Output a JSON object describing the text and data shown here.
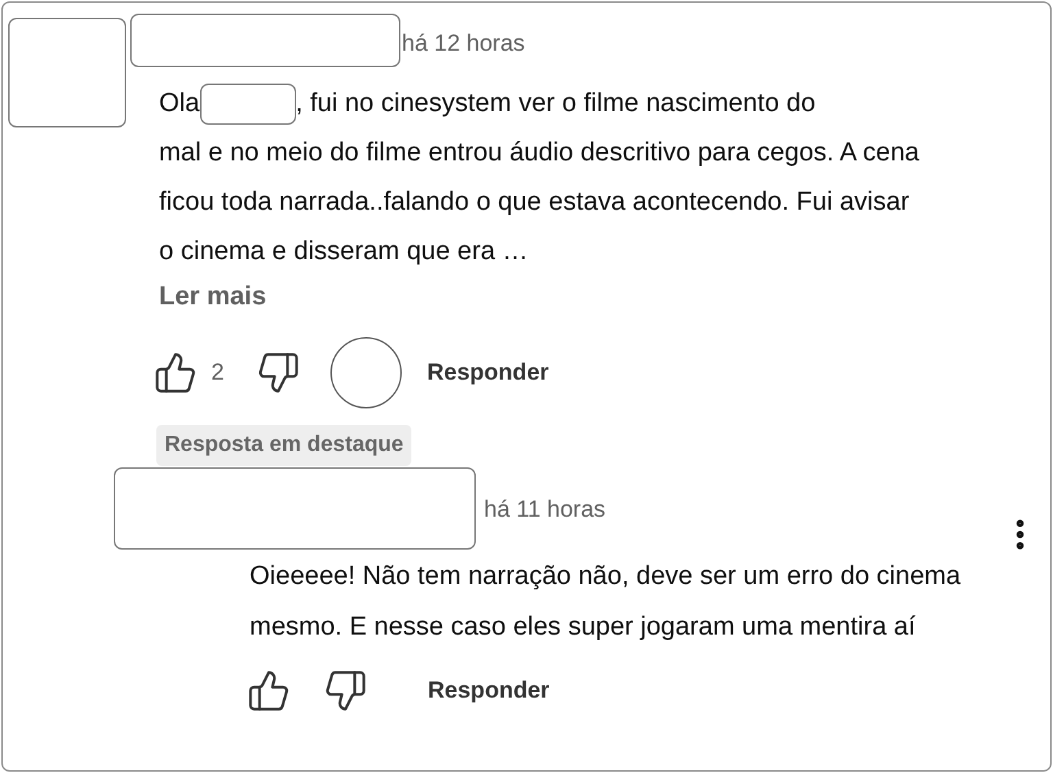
{
  "comment": {
    "time": "há 12 horas",
    "text_before": "Ola",
    "text_after": ", fui no cinesystem ver o filme nascimento do",
    "text_rest": "mal e no meio do filme entrou áudio descritivo para cegos. A cena ficou toda narrada..falando o que estava acontecendo. Fui avisar o cinema e disseram que era …",
    "read_more": "Ler mais",
    "like_count": "2",
    "reply_button": "Responder"
  },
  "featured_badge": "Resposta em destaque",
  "reply": {
    "time": "há 11 horas",
    "text": "Oieeeee! Não tem narração não, deve ser um erro do cinema mesmo. E nesse caso eles super jogaram uma mentira aí",
    "reply_button": "Responder"
  }
}
